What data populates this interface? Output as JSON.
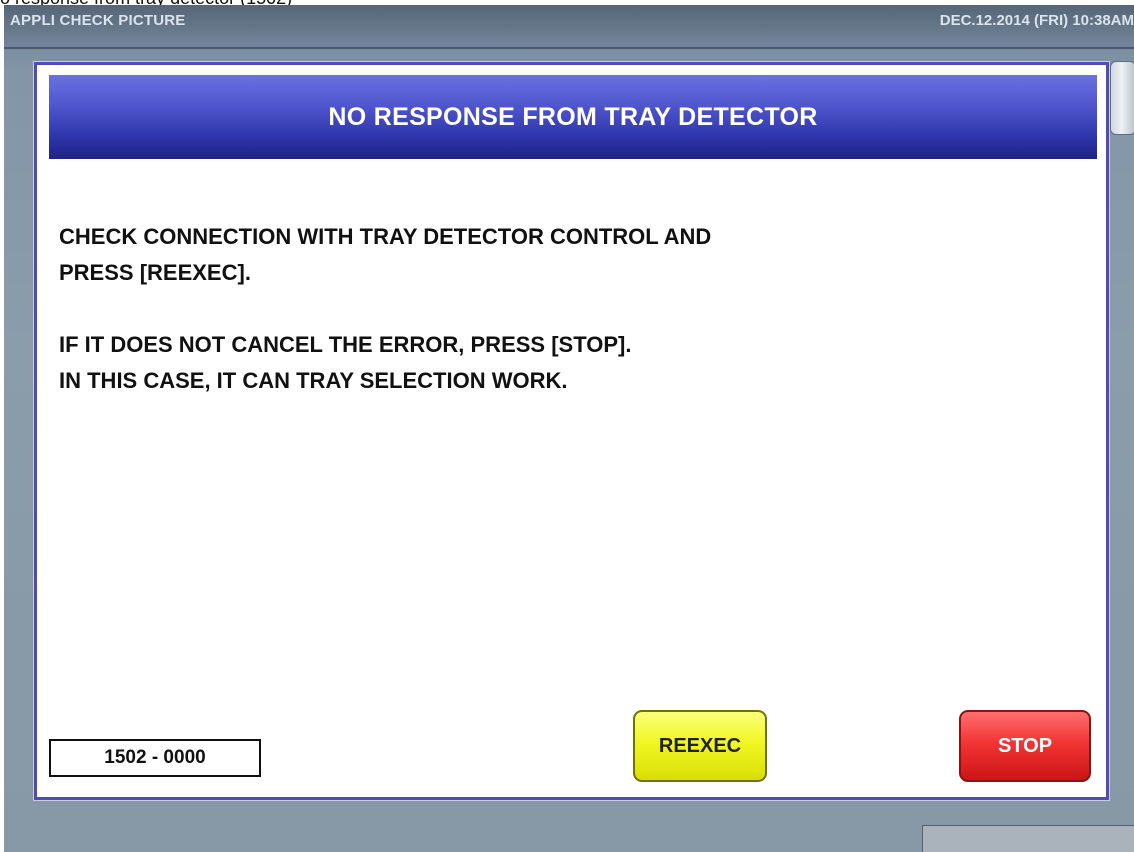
{
  "caption": "o response from tray detector (1502)",
  "topbar": {
    "app_title": "APPLI CHECK PICTURE",
    "datetime": "DEC.12.2014 (FRI)  10:38AM"
  },
  "dialog": {
    "title": "NO RESPONSE FROM TRAY DETECTOR",
    "message_lines": [
      "CHECK CONNECTION WITH TRAY DETECTOR CONTROL AND",
      "PRESS [REEXEC].",
      "IF IT DOES NOT CANCEL THE ERROR, PRESS [STOP].",
      "IN THIS CASE, IT CAN TRAY SELECTION WORK."
    ],
    "error_code": "1502 - 0000",
    "buttons": {
      "reexec": "REEXEC",
      "stop": "STOP"
    }
  },
  "colors": {
    "header_blue": "#2e34a8",
    "reexec_yellow": "#f1f722",
    "stop_red": "#f23535",
    "dialog_border": "#4f4cb8"
  }
}
